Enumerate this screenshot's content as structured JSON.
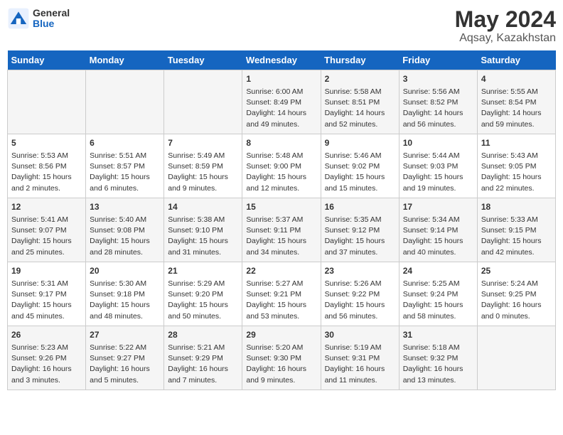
{
  "header": {
    "logo_general": "General",
    "logo_blue": "Blue",
    "title": "May 2024",
    "subtitle": "Aqsay, Kazakhstan"
  },
  "weekdays": [
    "Sunday",
    "Monday",
    "Tuesday",
    "Wednesday",
    "Thursday",
    "Friday",
    "Saturday"
  ],
  "weeks": [
    [
      {
        "day": "",
        "content": ""
      },
      {
        "day": "",
        "content": ""
      },
      {
        "day": "",
        "content": ""
      },
      {
        "day": "1",
        "content": "Sunrise: 6:00 AM\nSunset: 8:49 PM\nDaylight: 14 hours\nand 49 minutes."
      },
      {
        "day": "2",
        "content": "Sunrise: 5:58 AM\nSunset: 8:51 PM\nDaylight: 14 hours\nand 52 minutes."
      },
      {
        "day": "3",
        "content": "Sunrise: 5:56 AM\nSunset: 8:52 PM\nDaylight: 14 hours\nand 56 minutes."
      },
      {
        "day": "4",
        "content": "Sunrise: 5:55 AM\nSunset: 8:54 PM\nDaylight: 14 hours\nand 59 minutes."
      }
    ],
    [
      {
        "day": "5",
        "content": "Sunrise: 5:53 AM\nSunset: 8:56 PM\nDaylight: 15 hours\nand 2 minutes."
      },
      {
        "day": "6",
        "content": "Sunrise: 5:51 AM\nSunset: 8:57 PM\nDaylight: 15 hours\nand 6 minutes."
      },
      {
        "day": "7",
        "content": "Sunrise: 5:49 AM\nSunset: 8:59 PM\nDaylight: 15 hours\nand 9 minutes."
      },
      {
        "day": "8",
        "content": "Sunrise: 5:48 AM\nSunset: 9:00 PM\nDaylight: 15 hours\nand 12 minutes."
      },
      {
        "day": "9",
        "content": "Sunrise: 5:46 AM\nSunset: 9:02 PM\nDaylight: 15 hours\nand 15 minutes."
      },
      {
        "day": "10",
        "content": "Sunrise: 5:44 AM\nSunset: 9:03 PM\nDaylight: 15 hours\nand 19 minutes."
      },
      {
        "day": "11",
        "content": "Sunrise: 5:43 AM\nSunset: 9:05 PM\nDaylight: 15 hours\nand 22 minutes."
      }
    ],
    [
      {
        "day": "12",
        "content": "Sunrise: 5:41 AM\nSunset: 9:07 PM\nDaylight: 15 hours\nand 25 minutes."
      },
      {
        "day": "13",
        "content": "Sunrise: 5:40 AM\nSunset: 9:08 PM\nDaylight: 15 hours\nand 28 minutes."
      },
      {
        "day": "14",
        "content": "Sunrise: 5:38 AM\nSunset: 9:10 PM\nDaylight: 15 hours\nand 31 minutes."
      },
      {
        "day": "15",
        "content": "Sunrise: 5:37 AM\nSunset: 9:11 PM\nDaylight: 15 hours\nand 34 minutes."
      },
      {
        "day": "16",
        "content": "Sunrise: 5:35 AM\nSunset: 9:12 PM\nDaylight: 15 hours\nand 37 minutes."
      },
      {
        "day": "17",
        "content": "Sunrise: 5:34 AM\nSunset: 9:14 PM\nDaylight: 15 hours\nand 40 minutes."
      },
      {
        "day": "18",
        "content": "Sunrise: 5:33 AM\nSunset: 9:15 PM\nDaylight: 15 hours\nand 42 minutes."
      }
    ],
    [
      {
        "day": "19",
        "content": "Sunrise: 5:31 AM\nSunset: 9:17 PM\nDaylight: 15 hours\nand 45 minutes."
      },
      {
        "day": "20",
        "content": "Sunrise: 5:30 AM\nSunset: 9:18 PM\nDaylight: 15 hours\nand 48 minutes."
      },
      {
        "day": "21",
        "content": "Sunrise: 5:29 AM\nSunset: 9:20 PM\nDaylight: 15 hours\nand 50 minutes."
      },
      {
        "day": "22",
        "content": "Sunrise: 5:27 AM\nSunset: 9:21 PM\nDaylight: 15 hours\nand 53 minutes."
      },
      {
        "day": "23",
        "content": "Sunrise: 5:26 AM\nSunset: 9:22 PM\nDaylight: 15 hours\nand 56 minutes."
      },
      {
        "day": "24",
        "content": "Sunrise: 5:25 AM\nSunset: 9:24 PM\nDaylight: 15 hours\nand 58 minutes."
      },
      {
        "day": "25",
        "content": "Sunrise: 5:24 AM\nSunset: 9:25 PM\nDaylight: 16 hours\nand 0 minutes."
      }
    ],
    [
      {
        "day": "26",
        "content": "Sunrise: 5:23 AM\nSunset: 9:26 PM\nDaylight: 16 hours\nand 3 minutes."
      },
      {
        "day": "27",
        "content": "Sunrise: 5:22 AM\nSunset: 9:27 PM\nDaylight: 16 hours\nand 5 minutes."
      },
      {
        "day": "28",
        "content": "Sunrise: 5:21 AM\nSunset: 9:29 PM\nDaylight: 16 hours\nand 7 minutes."
      },
      {
        "day": "29",
        "content": "Sunrise: 5:20 AM\nSunset: 9:30 PM\nDaylight: 16 hours\nand 9 minutes."
      },
      {
        "day": "30",
        "content": "Sunrise: 5:19 AM\nSunset: 9:31 PM\nDaylight: 16 hours\nand 11 minutes."
      },
      {
        "day": "31",
        "content": "Sunrise: 5:18 AM\nSunset: 9:32 PM\nDaylight: 16 hours\nand 13 minutes."
      },
      {
        "day": "",
        "content": ""
      }
    ]
  ]
}
